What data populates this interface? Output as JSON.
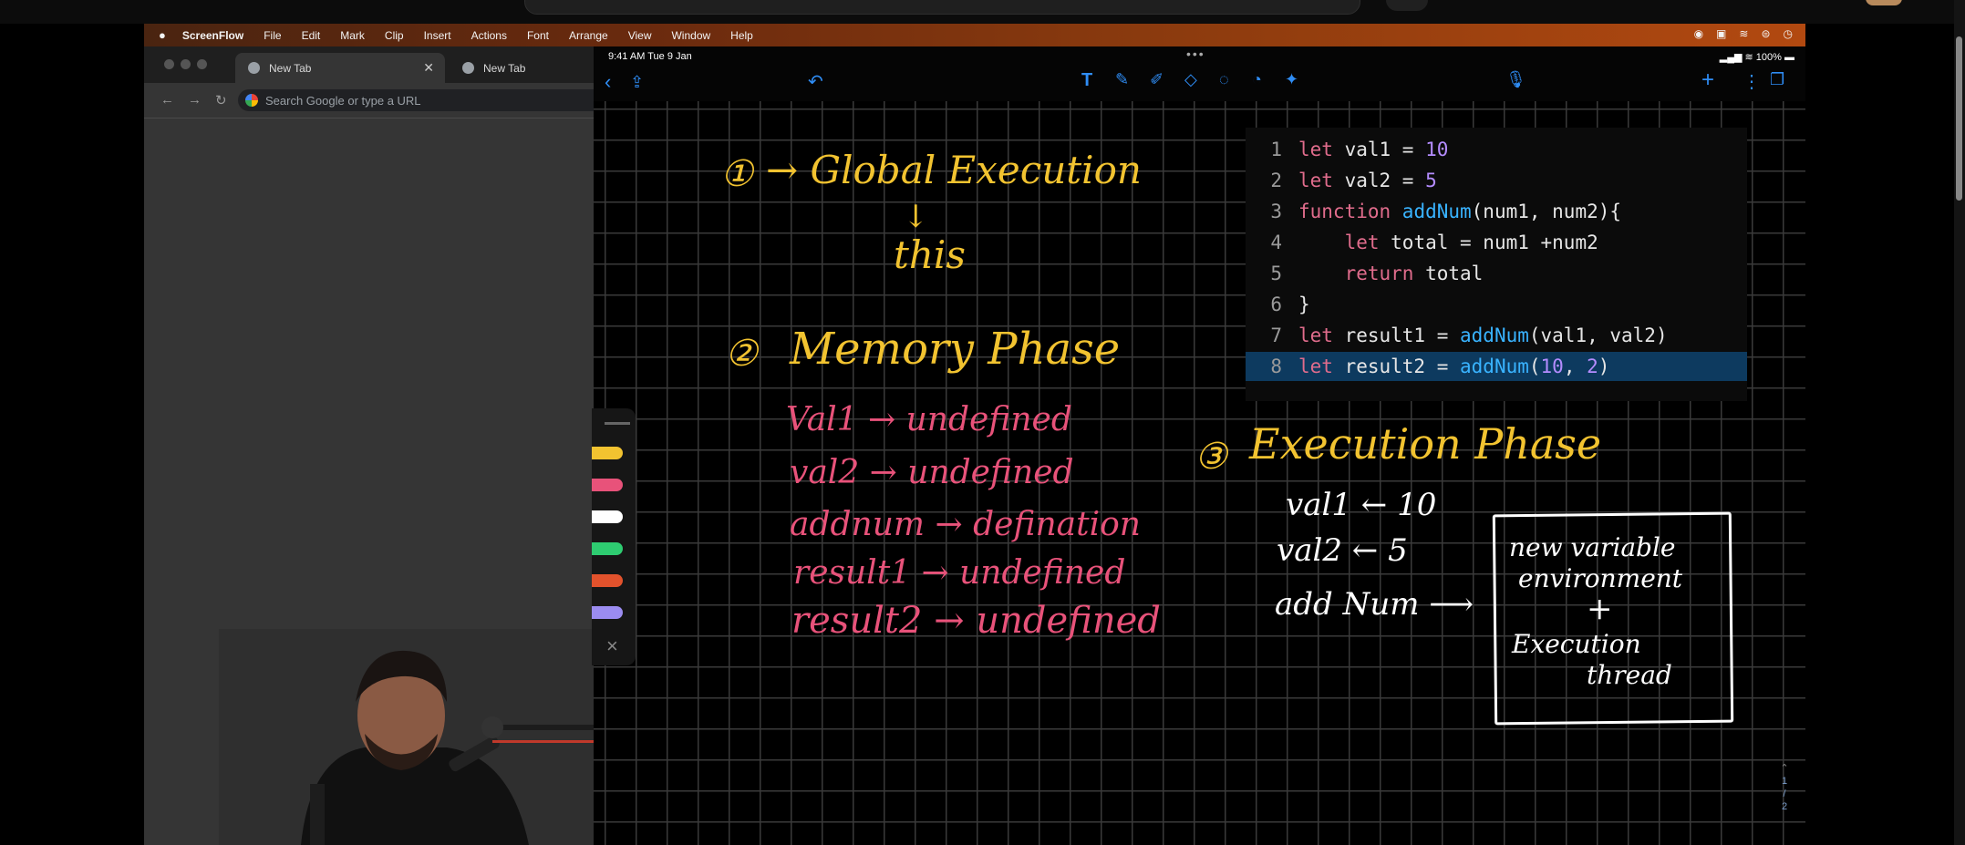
{
  "menubar": {
    "apple": "",
    "items": [
      "ScreenFlow",
      "File",
      "Edit",
      "Mark",
      "Clip",
      "Insert",
      "Actions",
      "Font",
      "Arrange",
      "View",
      "Window",
      "Help"
    ]
  },
  "chrome": {
    "tabs": [
      {
        "label": "New Tab"
      },
      {
        "label": "New Tab"
      }
    ],
    "omnibox_placeholder": "Search Google or type a URL"
  },
  "ipad": {
    "time": "9:41 AM  Tue 9 Jan",
    "battery": "100%"
  },
  "code": {
    "lines": [
      {
        "n": "1",
        "segments": [
          {
            "t": "let ",
            "c": "kw"
          },
          {
            "t": "val1 = ",
            "c": ""
          },
          {
            "t": "10",
            "c": "num"
          }
        ]
      },
      {
        "n": "2",
        "segments": [
          {
            "t": "let ",
            "c": "kw"
          },
          {
            "t": "val2 = ",
            "c": ""
          },
          {
            "t": "5",
            "c": "num"
          }
        ]
      },
      {
        "n": "3",
        "segments": [
          {
            "t": "function ",
            "c": "kw"
          },
          {
            "t": "addNum",
            "c": "fn"
          },
          {
            "t": "(num1, num2){",
            "c": ""
          }
        ]
      },
      {
        "n": "4",
        "segments": [
          {
            "t": "    let ",
            "c": "kw"
          },
          {
            "t": "total = num1 +num2",
            "c": ""
          }
        ]
      },
      {
        "n": "5",
        "segments": [
          {
            "t": "    return ",
            "c": "kw"
          },
          {
            "t": "total",
            "c": ""
          }
        ]
      },
      {
        "n": "6",
        "segments": [
          {
            "t": "}",
            "c": ""
          }
        ]
      },
      {
        "n": "7",
        "segments": [
          {
            "t": "let ",
            "c": "kw"
          },
          {
            "t": "result1 = ",
            "c": ""
          },
          {
            "t": "addNum",
            "c": "fn"
          },
          {
            "t": "(val1, val2)",
            "c": ""
          }
        ]
      },
      {
        "n": "8",
        "segments": [
          {
            "t": "let ",
            "c": "kw"
          },
          {
            "t": "result2 = ",
            "c": ""
          },
          {
            "t": "addNum",
            "c": "fn"
          },
          {
            "t": "(",
            "c": ""
          },
          {
            "t": "10",
            "c": "num"
          },
          {
            "t": ", ",
            "c": ""
          },
          {
            "t": "2",
            "c": "num"
          },
          {
            "t": ")",
            "c": ""
          }
        ],
        "highlight": true
      }
    ]
  },
  "notes": {
    "step1_num": "①",
    "step1": "→ Global Execution",
    "step1_arrow": "↓",
    "this": "this",
    "step2_num": "②",
    "step2": "Memory Phase",
    "memory": [
      "Val1 → undefined",
      "val2 → undefined",
      "addnum → defination",
      "result1 → undefined",
      "result2 → undefined"
    ],
    "step3_num": "③",
    "step3": "Execution Phase",
    "exec": [
      "val1 ← 10",
      "val2 ← 5",
      "add Num ⟶"
    ],
    "box": [
      "new variable",
      "environment",
      "+",
      "Execution",
      "thread"
    ]
  },
  "palette": {
    "colors": [
      "#f2c330",
      "#e8527a",
      "#ffffff",
      "#2ecc71",
      "#e2522c",
      "#9b8cf0"
    ],
    "close": "×"
  },
  "page_marker": [
    "1",
    "/",
    "2"
  ]
}
